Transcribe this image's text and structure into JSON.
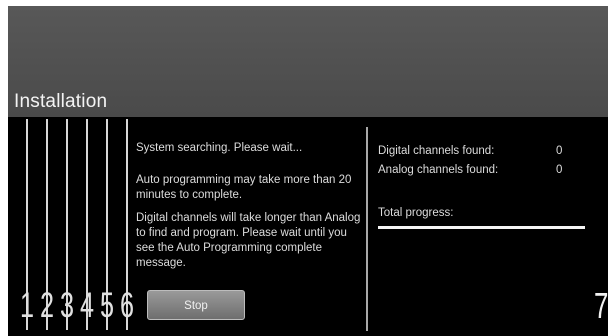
{
  "header": {
    "title": "Installation"
  },
  "steps": [
    "1",
    "2",
    "3",
    "4",
    "5",
    "6"
  ],
  "current_step": "7",
  "message": {
    "line1": "System searching. Please wait...",
    "para1": "Auto programming may take more than 20 minutes to complete.",
    "para2": "Digital channels will take longer than Analog to find and program. Please wait until you see the Auto Programming complete message."
  },
  "stop_button": {
    "label": "Stop"
  },
  "stats": {
    "digital_label": "Digital channels found:",
    "digital_value": "0",
    "analog_label": "Analog channels found:",
    "analog_value": "0",
    "total_progress_label": "Total progress:",
    "total_progress_fraction": 1.0
  },
  "colors": {
    "header_bg": "#505050",
    "body_bg": "#000000",
    "button_bg": "#8a8a8a",
    "text": "#dcdcdc"
  }
}
